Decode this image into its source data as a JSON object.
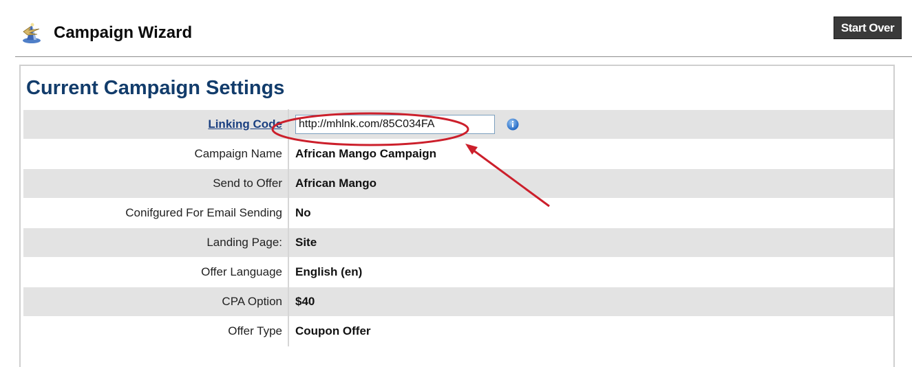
{
  "header": {
    "title": "Campaign Wizard",
    "start_over_label": "Start Over",
    "logo_icon": "wizard-icon"
  },
  "panel": {
    "title": "Current Campaign Settings",
    "linking_code": {
      "label": "Linking Code",
      "value": "http://mhlnk.com/85C034FA",
      "info_icon": "info-icon"
    },
    "rows": [
      {
        "label": "Campaign Name",
        "value": "African Mango Campaign"
      },
      {
        "label": "Send to Offer",
        "value": "African Mango"
      },
      {
        "label": "Conifgured For Email Sending",
        "value": "No"
      },
      {
        "label": "Landing Page:",
        "value": "Site"
      },
      {
        "label": "Offer Language",
        "value": "English (en)"
      },
      {
        "label": "CPA Option",
        "value": "$40"
      },
      {
        "label": "Offer Type",
        "value": "Coupon Offer"
      }
    ]
  },
  "annotation": {
    "color": "#cc1f2b",
    "shape": "ellipse-and-arrow"
  }
}
